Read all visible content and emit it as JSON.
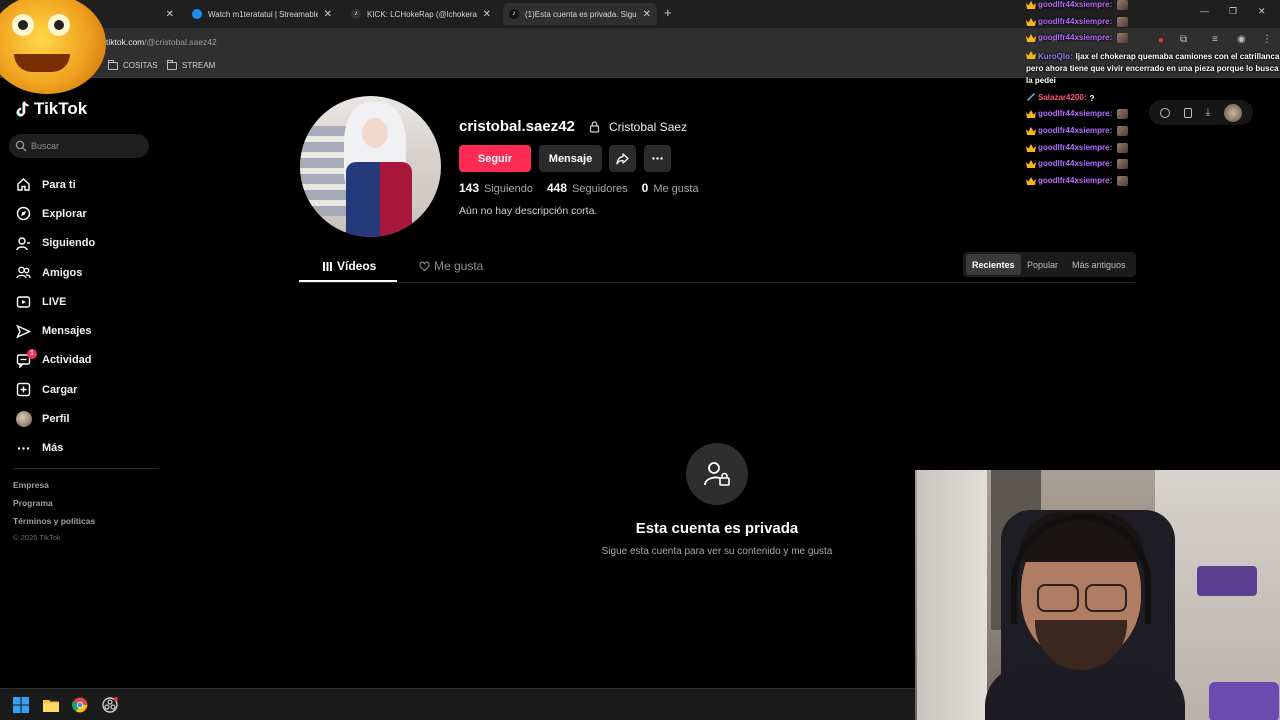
{
  "browser": {
    "tabs": [
      {
        "label": "Watch m1teratatui | Streamable",
        "active": false
      },
      {
        "label": "KICK: LCHokeRap (@lchokerap",
        "active": false
      },
      {
        "label": "(1)Esta cuenta es privada. Sigue",
        "active": true
      }
    ],
    "url_host": "tiktok.com",
    "url_path": "/@cristobal.saez42",
    "bookmarks": [
      "COSITAS",
      "STREAM"
    ]
  },
  "sidebar": {
    "logo": "TikTok",
    "search_placeholder": "Buscar",
    "nav": [
      {
        "label": "Para ti",
        "icon": "home-icon"
      },
      {
        "label": "Explorar",
        "icon": "compass-icon"
      },
      {
        "label": "Siguiendo",
        "icon": "following-icon"
      },
      {
        "label": "Amigos",
        "icon": "friends-icon"
      },
      {
        "label": "LIVE",
        "icon": "live-icon"
      },
      {
        "label": "Mensajes",
        "icon": "messages-icon"
      },
      {
        "label": "Actividad",
        "icon": "activity-icon",
        "badge": "1"
      },
      {
        "label": "Cargar",
        "icon": "upload-icon"
      },
      {
        "label": "Perfil",
        "icon": "avatar"
      },
      {
        "label": "Más",
        "icon": "more-icon"
      }
    ],
    "footer_links": [
      "Empresa",
      "Programa",
      "Términos y políticas"
    ],
    "copyright": "© 2026 TikTok"
  },
  "profile": {
    "username": "cristobal.saez42",
    "nickname": "Cristobal Saez",
    "follow_label": "Seguir",
    "message_label": "Mensaje",
    "stats": [
      {
        "value": "143",
        "label": "Siguiendo"
      },
      {
        "value": "448",
        "label": "Seguidores"
      },
      {
        "value": "0",
        "label": "Me gusta"
      }
    ],
    "bio": "Aún no hay descripción corta."
  },
  "content_tabs": {
    "videos": "Vídeos",
    "likes": "Me gusta",
    "sort": [
      "Recientes",
      "Popular",
      "Más antiguos"
    ],
    "sort_active": "Recientes"
  },
  "private": {
    "title": "Esta cuenta es privada",
    "subtitle": "Sigue esta cuenta para ver su contenido y me gusta"
  },
  "chat": [
    {
      "user": "goodlfr44xsiempre:",
      "msg": "",
      "type": "crown"
    },
    {
      "user": "goodlfr44xsiempre:",
      "msg": "",
      "type": "crown"
    },
    {
      "user": "goodlfr44xsiempre:",
      "msg": "",
      "type": "crown"
    },
    {
      "user": "KuroQlo:",
      "msg": "Ijax el chokerap quemaba camiones con el catrillanca pero ahora tiene que vivir encerrado en una pieza porque lo busca la pedei",
      "type": "crown"
    },
    {
      "user": "Salazar4200:",
      "msg": "?",
      "type": "sword"
    },
    {
      "user": "goodlfr44xsiempre:",
      "msg": "",
      "type": "crown"
    },
    {
      "user": "goodlfr44xsiempre:",
      "msg": "",
      "type": "crown"
    },
    {
      "user": "goodlfr44xsiempre:",
      "msg": "",
      "type": "crown"
    },
    {
      "user": "goodlfr44xsiempre:",
      "msg": "",
      "type": "crown"
    },
    {
      "user": "goodlfr44xsiempre:",
      "msg": "",
      "type": "crown"
    }
  ],
  "colors": {
    "accent": "#fe2c55",
    "chat_user": "#b66cff"
  }
}
